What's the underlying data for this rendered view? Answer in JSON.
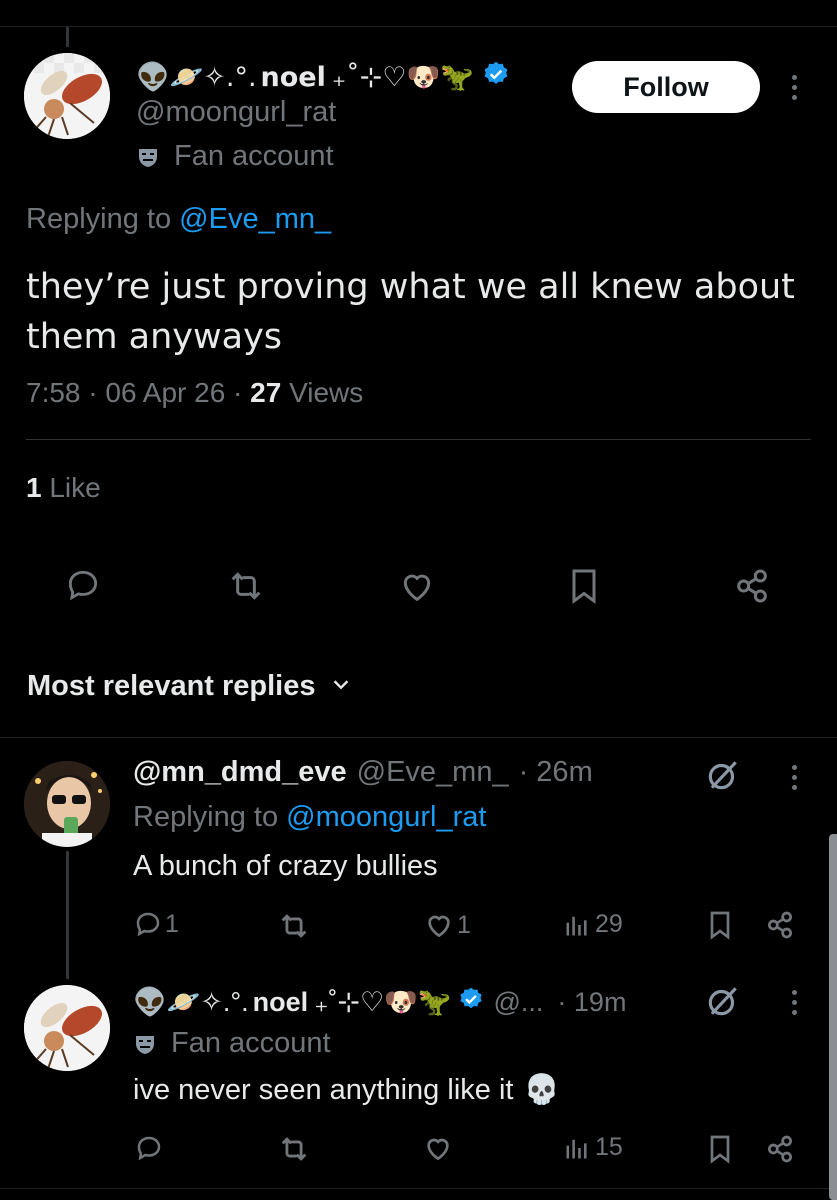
{
  "main_tweet": {
    "display_name": "noel",
    "name_prefix": "👽🪐✧.°.",
    "name_suffix": "₊˚⊹♡🐶🦖",
    "handle": "@moongurl_rat",
    "affiliation_icon": "theater-mask-icon",
    "affiliation": "Fan account",
    "follow_label": "Follow",
    "replying_prefix": "Replying to",
    "replying_to": "@Eve_mn_",
    "text": "they’re just proving what we all knew about them anyways",
    "time": "7:58",
    "date": "06 Apr 26",
    "views_count": "27",
    "views_label": "Views",
    "likes_count": "1",
    "likes_label": "Like",
    "colors": {
      "accent": "#1d9bf0",
      "muted": "#71767b",
      "text": "#e7e9ea",
      "background": "#000000"
    }
  },
  "replies_header": {
    "label": "Most relevant replies"
  },
  "replies": [
    {
      "display_name": "@mn_dmd_eve",
      "handle": "@Eve_mn_",
      "time": "· 26m",
      "replying_prefix": "Replying to",
      "replying_to": "@moongurl_rat",
      "text": "A bunch of crazy bullies",
      "reply_count": "1",
      "like_count": "1",
      "view_count": "29"
    },
    {
      "display_name": "noel",
      "name_prefix": "👽🪐✧.°.",
      "name_suffix": "₊˚⊹♡🐶🦖",
      "handle": "@...",
      "time": "· 19m",
      "affiliation_icon": "theater-mask-icon",
      "affiliation": "Fan account",
      "text": "ive never seen anything like it",
      "text_emoji": "💀",
      "view_count": "15"
    }
  ]
}
